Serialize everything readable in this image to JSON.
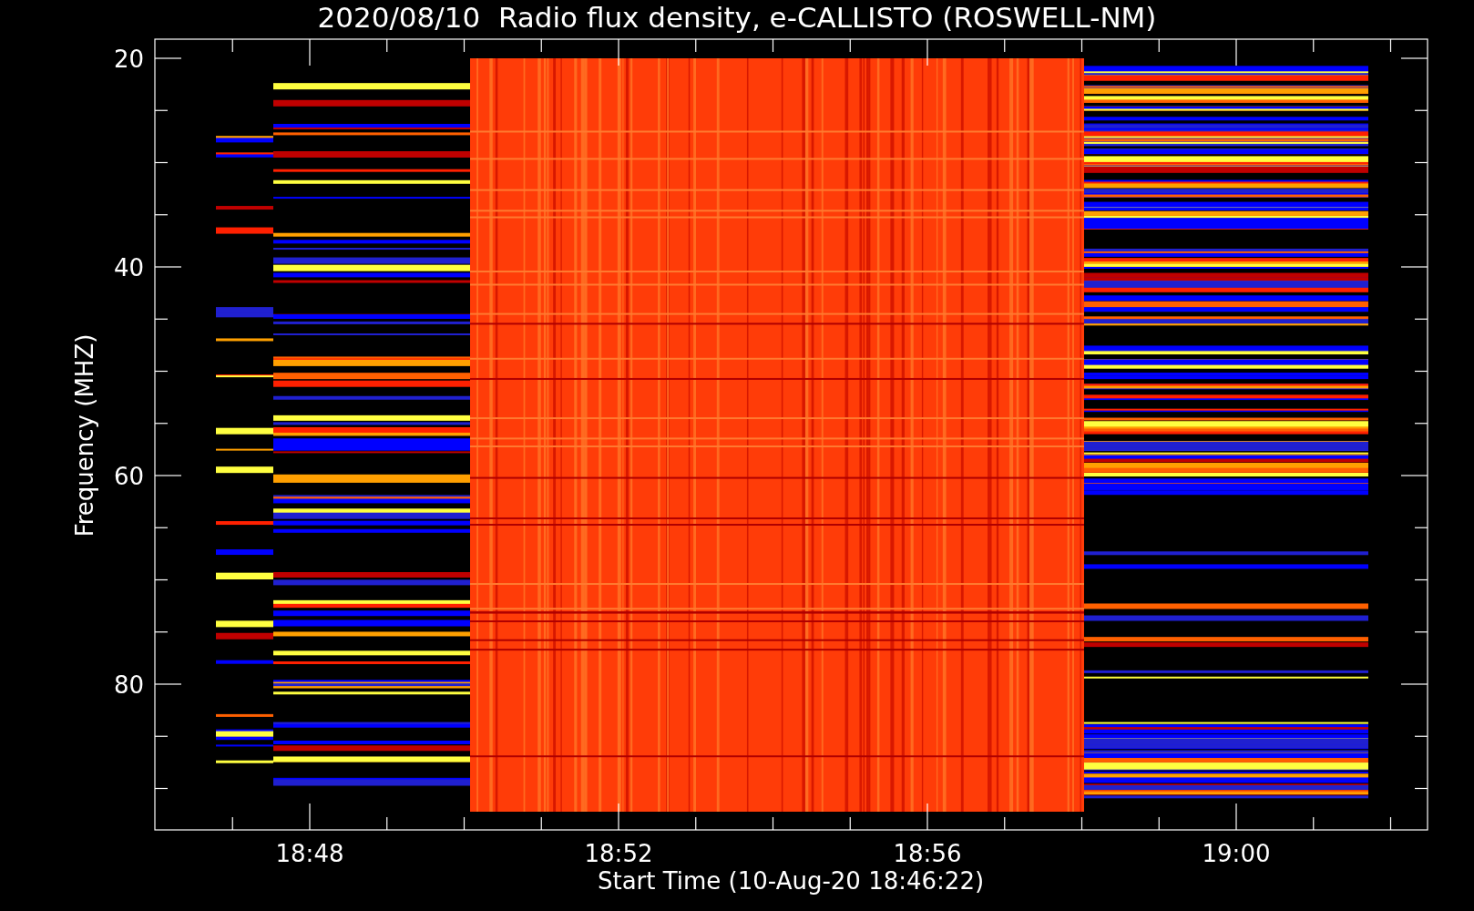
{
  "title": "2020/08/10  Radio flux density, e-CALLISTO (ROSWELL-NM)",
  "plot": {
    "y_axis": {
      "label": "Frequency (MHZ)",
      "ticks": [
        "20",
        "40",
        "60",
        "80"
      ]
    },
    "x_axis": {
      "label": "Start Time (10-Aug-20 18:46:22)",
      "ticks": [
        "18:48",
        "18:52",
        "18:56",
        "19:00"
      ]
    }
  }
}
